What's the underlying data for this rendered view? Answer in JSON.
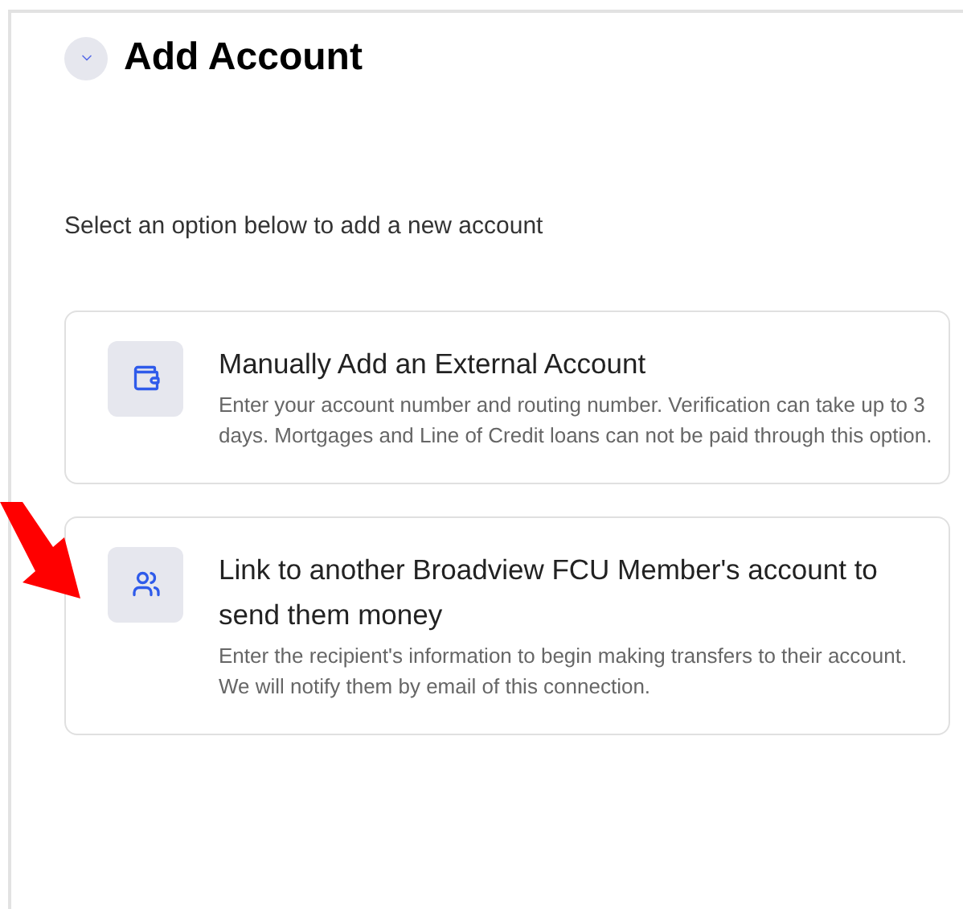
{
  "header": {
    "title": "Add Account",
    "expanded": false
  },
  "intro": "Select an option below to add a new account",
  "options": [
    {
      "kind": "wallet",
      "title": "Manually Add an External Account",
      "description": "Enter your account number and routing number. Verification can take up to 3 days. Mortgages and Line of Credit loans can not be paid through this option."
    },
    {
      "kind": "people",
      "title": "Link to another Broadview FCU Member's account to send them money",
      "description": "Enter the recipient's information to begin making transfers to their account. We will notify them by email of this connection."
    }
  ]
}
